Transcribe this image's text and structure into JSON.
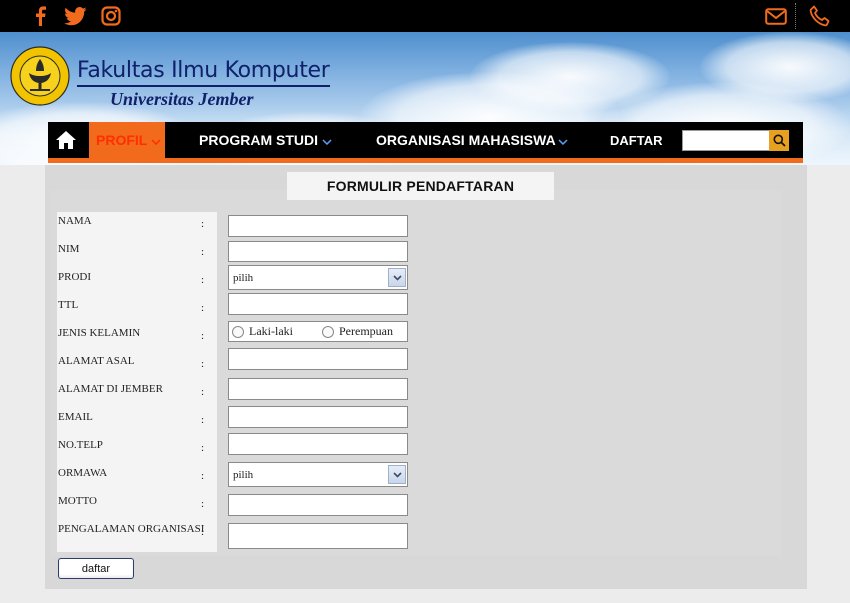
{
  "topbar": {
    "social": [
      "facebook-icon",
      "twitter-icon",
      "instagram-icon"
    ],
    "contact": [
      "mail-icon",
      "phone-icon"
    ],
    "icon_color": "#f26b1d"
  },
  "header": {
    "title": "Fakultas Ilmu Komputer",
    "subtitle": "Universitas Jember"
  },
  "nav": {
    "items": [
      {
        "label": "PROFIL"
      },
      {
        "label": "PROGRAM STUDI"
      },
      {
        "label": "ORGANISASI MAHASISWA"
      },
      {
        "label": "DAFTAR"
      }
    ],
    "search_placeholder": "",
    "accent": "#f26b1d"
  },
  "form": {
    "title": "FORMULIR PENDAFTARAN",
    "colon": ":",
    "fields": [
      {
        "label": "NAMA",
        "value": ""
      },
      {
        "label": "NIM",
        "value": ""
      },
      {
        "label": "PRODI",
        "value": "pilih"
      },
      {
        "label": "TTL",
        "value": ""
      },
      {
        "label": "JENIS KELAMIN",
        "value": ""
      },
      {
        "label": "ALAMAT ASAL",
        "value": ""
      },
      {
        "label": "ALAMAT DI JEMBER",
        "value": ""
      },
      {
        "label": "EMAIL",
        "value": ""
      },
      {
        "label": "NO.TELP",
        "value": ""
      },
      {
        "label": "ORMAWA",
        "value": "pilih"
      },
      {
        "label": "MOTTO",
        "value": ""
      },
      {
        "label": "PENGALAMAN ORGANISASI",
        "value": ""
      }
    ],
    "gender_options": [
      "Laki-laki",
      "Perempuan"
    ],
    "submit_label": "daftar"
  }
}
